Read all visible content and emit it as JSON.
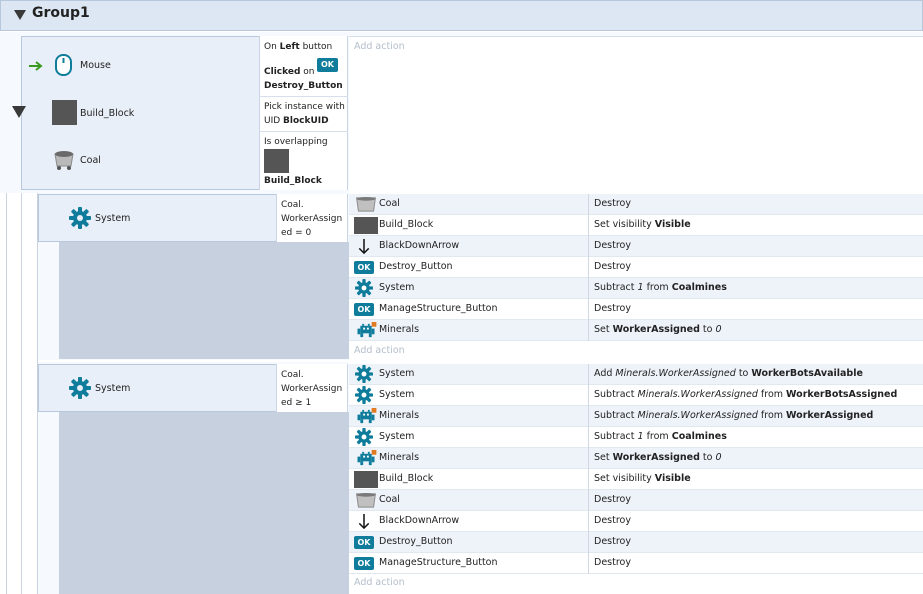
{
  "group": {
    "title": "Group1"
  },
  "main_event": {
    "conditions": [
      {
        "object": "Mouse",
        "icon": "mouse-icon"
      },
      {
        "object": "Build_Block",
        "icon": "build-block-icon"
      },
      {
        "object": "Coal",
        "icon": "coal-cart-icon"
      }
    ],
    "params": {
      "p1_prefix": "On ",
      "p1_bold": "Left",
      "p1_suffix": " button",
      "p2_bold": "Clicked",
      "p2_on": " on",
      "p2_badge": "OK",
      "p2_obj": "Destroy_Button",
      "p3_line1": "Pick instance with",
      "p3_prefix": "UID ",
      "p3_bold": "BlockUID",
      "p4_line1": "Is overlapping",
      "p4_obj": "Build_Block"
    },
    "add_action": "Add action"
  },
  "sub1": {
    "condition": {
      "object": "System",
      "param_l1": "Coal.",
      "param_l2": "WorkerAssign",
      "param_l3": "ed = 0"
    },
    "actions": [
      {
        "obj": "Coal",
        "icon": "coal-cart-icon",
        "d": [
          [
            "n",
            "Destroy"
          ]
        ]
      },
      {
        "obj": "Build_Block",
        "icon": "build-block-icon",
        "d": [
          [
            "n",
            "Set visibility "
          ],
          [
            "b",
            "Visible"
          ]
        ]
      },
      {
        "obj": "BlackDownArrow",
        "icon": "down-arrow-icon",
        "d": [
          [
            "n",
            "Destroy"
          ]
        ]
      },
      {
        "obj": "Destroy_Button",
        "icon": "ok-button-icon",
        "d": [
          [
            "n",
            "Destroy"
          ]
        ]
      },
      {
        "obj": "System",
        "icon": "gear-icon",
        "d": [
          [
            "n",
            "Subtract "
          ],
          [
            "i",
            "1"
          ],
          [
            "n",
            " from "
          ],
          [
            "b",
            "Coalmines"
          ]
        ]
      },
      {
        "obj": "ManageStructure_Button",
        "icon": "ok-button-icon",
        "d": [
          [
            "n",
            "Destroy"
          ]
        ]
      },
      {
        "obj": "Minerals",
        "icon": "invader-icon",
        "d": [
          [
            "n",
            "Set "
          ],
          [
            "b",
            "WorkerAssigned"
          ],
          [
            "n",
            " to "
          ],
          [
            "i",
            "0"
          ]
        ]
      }
    ],
    "add_action": "Add action"
  },
  "sub2": {
    "condition": {
      "object": "System",
      "param_l1": "Coal.",
      "param_l2": "WorkerAssign",
      "param_l3": "ed ≥ 1"
    },
    "actions": [
      {
        "obj": "System",
        "icon": "gear-icon",
        "d": [
          [
            "n",
            "Add "
          ],
          [
            "i",
            "Minerals.WorkerAssigned"
          ],
          [
            "n",
            " to "
          ],
          [
            "b",
            "WorkerBotsAvailable"
          ]
        ]
      },
      {
        "obj": "System",
        "icon": "gear-icon",
        "d": [
          [
            "n",
            "Subtract "
          ],
          [
            "i",
            "Minerals.WorkerAssigned"
          ],
          [
            "n",
            " from "
          ],
          [
            "b",
            "WorkerBotsAssigned"
          ]
        ]
      },
      {
        "obj": "Minerals",
        "icon": "invader-icon",
        "d": [
          [
            "n",
            "Subtract "
          ],
          [
            "i",
            "Minerals.WorkerAssigned"
          ],
          [
            "n",
            " from "
          ],
          [
            "b",
            "WorkerAssigned"
          ]
        ]
      },
      {
        "obj": "System",
        "icon": "gear-icon",
        "d": [
          [
            "n",
            "Subtract "
          ],
          [
            "i",
            "1"
          ],
          [
            "n",
            " from "
          ],
          [
            "b",
            "Coalmines"
          ]
        ]
      },
      {
        "obj": "Minerals",
        "icon": "invader-icon",
        "d": [
          [
            "n",
            "Set "
          ],
          [
            "b",
            "WorkerAssigned"
          ],
          [
            "n",
            " to "
          ],
          [
            "i",
            "0"
          ]
        ]
      },
      {
        "obj": "Build_Block",
        "icon": "build-block-icon",
        "d": [
          [
            "n",
            "Set visibility "
          ],
          [
            "b",
            "Visible"
          ]
        ]
      },
      {
        "obj": "Coal",
        "icon": "coal-cart-icon",
        "d": [
          [
            "n",
            "Destroy"
          ]
        ]
      },
      {
        "obj": "BlackDownArrow",
        "icon": "down-arrow-icon",
        "d": [
          [
            "n",
            "Destroy"
          ]
        ]
      },
      {
        "obj": "Destroy_Button",
        "icon": "ok-button-icon",
        "d": [
          [
            "n",
            "Destroy"
          ]
        ]
      },
      {
        "obj": "ManageStructure_Button",
        "icon": "ok-button-icon",
        "d": [
          [
            "n",
            "Destroy"
          ]
        ]
      }
    ],
    "add_action": "Add action"
  },
  "colors": {
    "accent": "#0e7c9a",
    "arrow": "#3a9a1e",
    "block": "#555555"
  }
}
